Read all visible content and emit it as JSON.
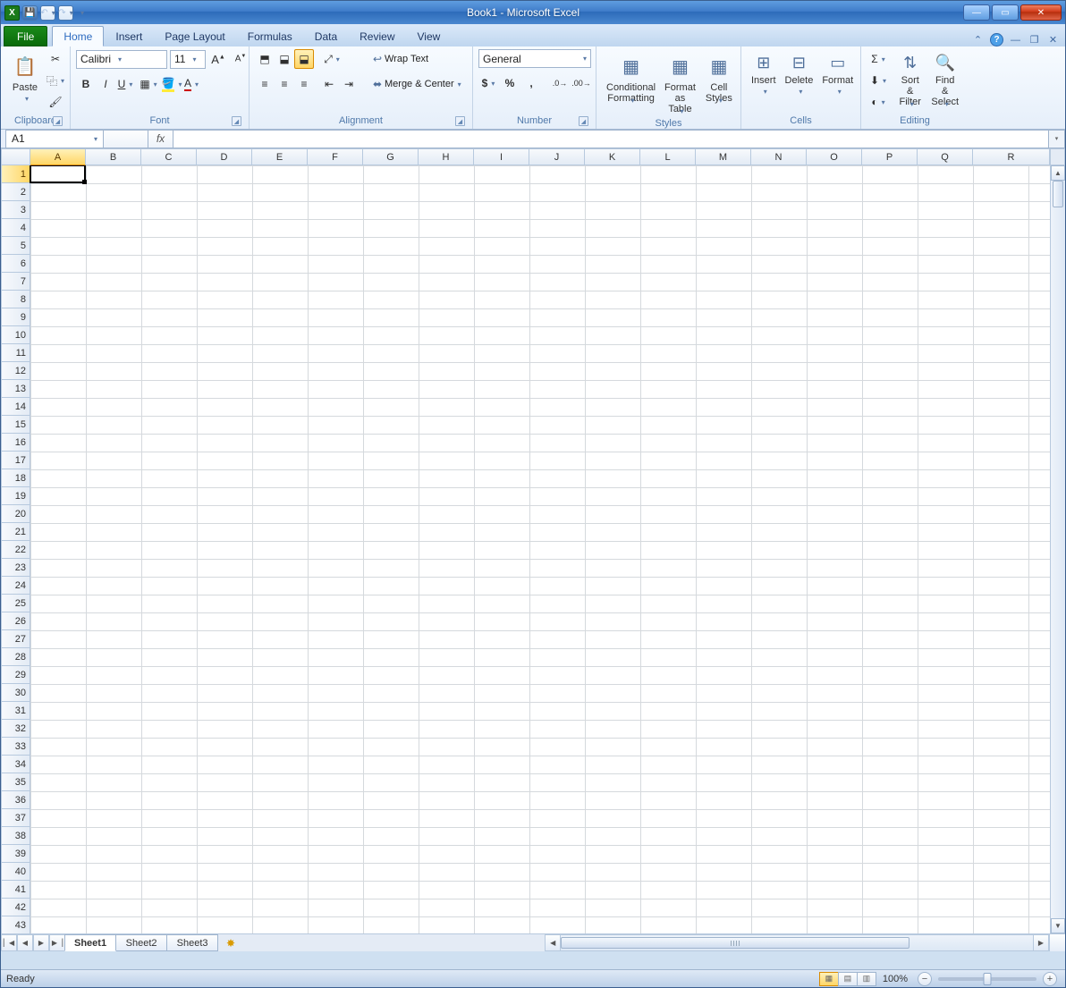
{
  "title": "Book1 - Microsoft Excel",
  "qat": {
    "save_icon": "save-icon",
    "undo_icon": "undo-icon",
    "redo_icon": "redo-icon"
  },
  "tabs": {
    "file": "File",
    "items": [
      "Home",
      "Insert",
      "Page Layout",
      "Formulas",
      "Data",
      "Review",
      "View"
    ],
    "active": "Home"
  },
  "ribbon": {
    "clipboard": {
      "label": "Clipboard",
      "paste": "Paste"
    },
    "font": {
      "label": "Font",
      "name": "Calibri",
      "size": "11",
      "bold": "B",
      "italic": "I",
      "underline": "U"
    },
    "alignment": {
      "label": "Alignment",
      "wrap": "Wrap Text",
      "merge": "Merge & Center"
    },
    "number": {
      "label": "Number",
      "format": "General",
      "currency": "$",
      "percent": "%",
      "comma": ",",
      "inc": ".0→.00",
      "dec": ".00→.0"
    },
    "styles": {
      "label": "Styles",
      "conditional": "Conditional\nFormatting",
      "table": "Format\nas Table",
      "cell": "Cell\nStyles"
    },
    "cells": {
      "label": "Cells",
      "insert": "Insert",
      "delete": "Delete",
      "format": "Format"
    },
    "editing": {
      "label": "Editing",
      "sort": "Sort &\nFilter",
      "find": "Find &\nSelect"
    }
  },
  "namebox": "A1",
  "fx_label": "fx",
  "grid": {
    "columns": [
      "A",
      "B",
      "C",
      "D",
      "E",
      "F",
      "G",
      "H",
      "I",
      "J",
      "K",
      "L",
      "M",
      "N",
      "O",
      "P",
      "Q",
      "R"
    ],
    "rows": [
      "1",
      "2",
      "3",
      "4",
      "5",
      "6",
      "7",
      "8",
      "9",
      "10",
      "11",
      "12",
      "13",
      "14",
      "15",
      "16",
      "17",
      "18",
      "19",
      "20",
      "21",
      "22",
      "23",
      "24",
      "25",
      "26",
      "27",
      "28",
      "29",
      "30",
      "31",
      "32",
      "33",
      "34",
      "35",
      "36",
      "37",
      "38",
      "39",
      "40",
      "41",
      "42",
      "43"
    ],
    "selected_cell": "A1",
    "selected_col": "A",
    "selected_row": "1"
  },
  "sheets": {
    "items": [
      "Sheet1",
      "Sheet2",
      "Sheet3"
    ],
    "active": "Sheet1"
  },
  "status": {
    "left": "Ready",
    "zoom": "100%"
  }
}
